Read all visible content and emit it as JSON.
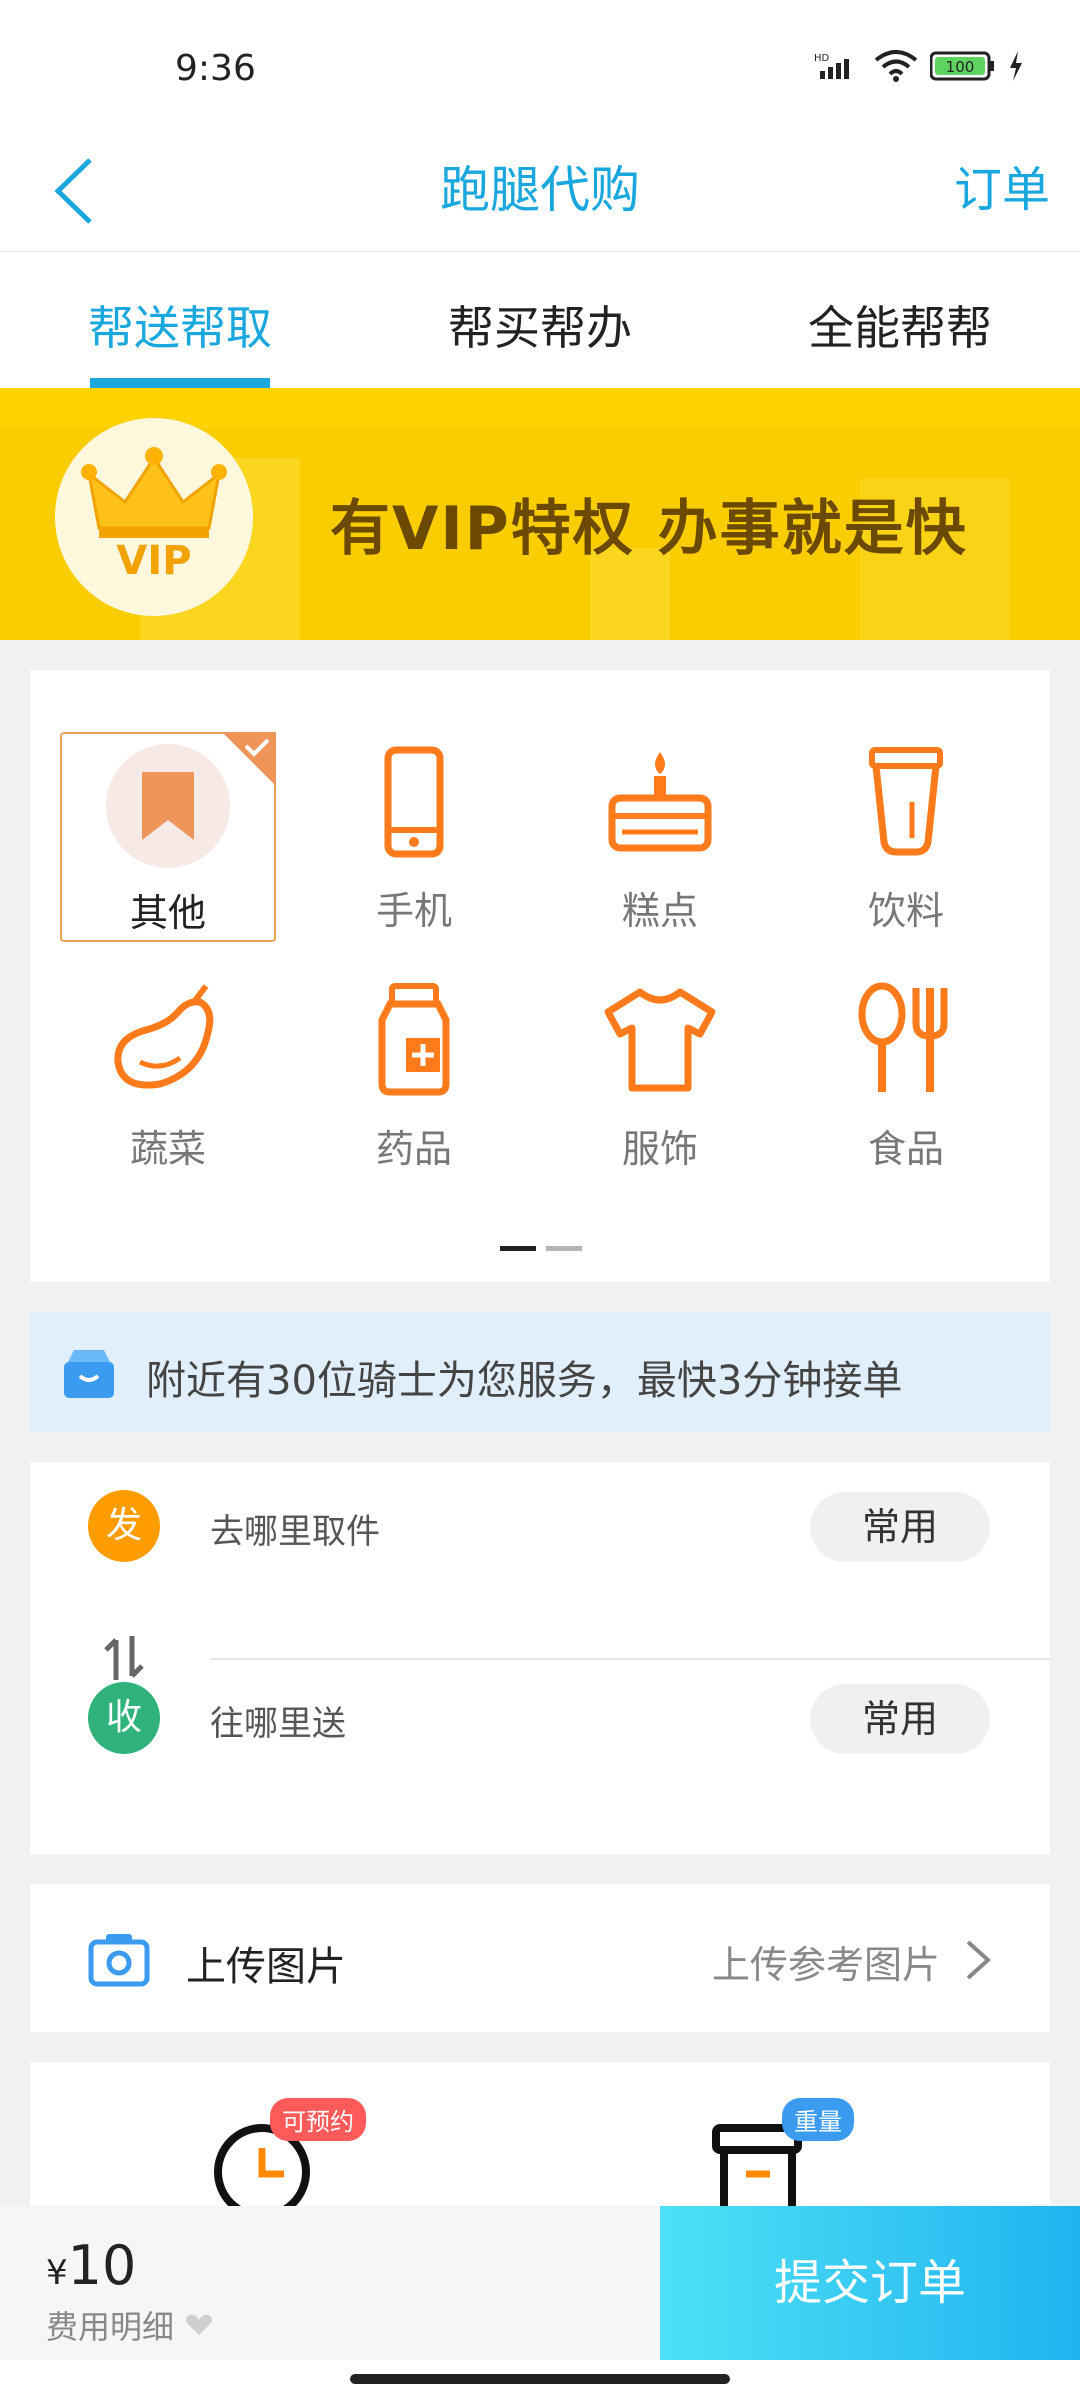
{
  "status_bar": {
    "time": "9:36",
    "battery": "100",
    "network": "HD"
  },
  "header": {
    "title": "跑腿代购",
    "right_link": "订单"
  },
  "tabs": [
    {
      "label": "帮送帮取",
      "active": true
    },
    {
      "label": "帮买帮办",
      "active": false
    },
    {
      "label": "全能帮帮",
      "active": false
    }
  ],
  "banner": {
    "badge_text": "VIP",
    "slogan": "有VIP特权  办事就是快"
  },
  "categories": [
    {
      "label": "其他",
      "icon": "bookmark-icon",
      "selected": true
    },
    {
      "label": "手机",
      "icon": "phone-icon"
    },
    {
      "label": "糕点",
      "icon": "cake-icon"
    },
    {
      "label": "饮料",
      "icon": "drink-cup-icon"
    },
    {
      "label": "蔬菜",
      "icon": "eggplant-icon"
    },
    {
      "label": "药品",
      "icon": "medicine-bottle-icon"
    },
    {
      "label": "服饰",
      "icon": "tshirt-icon"
    },
    {
      "label": "食品",
      "icon": "spoon-fork-icon"
    }
  ],
  "carousel": {
    "pages": 2,
    "current": 1
  },
  "notice": {
    "icon": "box-icon",
    "text": "附近有30位骑士为您服务，最快3分钟接单"
  },
  "address": {
    "pickup": {
      "badge": "发",
      "placeholder": "去哪里取件",
      "common": "常用"
    },
    "delivery": {
      "badge": "收",
      "placeholder": "往哪里送",
      "common": "常用"
    }
  },
  "upload": {
    "label": "上传图片",
    "hint": "上传参考图片"
  },
  "options": [
    {
      "icon": "clock-icon",
      "tag": "可预约"
    },
    {
      "icon": "package-box-icon",
      "tag": "重量"
    }
  ],
  "footer": {
    "currency": "¥",
    "price": "10",
    "detail_label": "费用明细",
    "submit_label": "提交订单"
  },
  "colors": {
    "accent": "#1aa7dd",
    "orange": "#ff8a00",
    "banner": "#ffd200"
  }
}
